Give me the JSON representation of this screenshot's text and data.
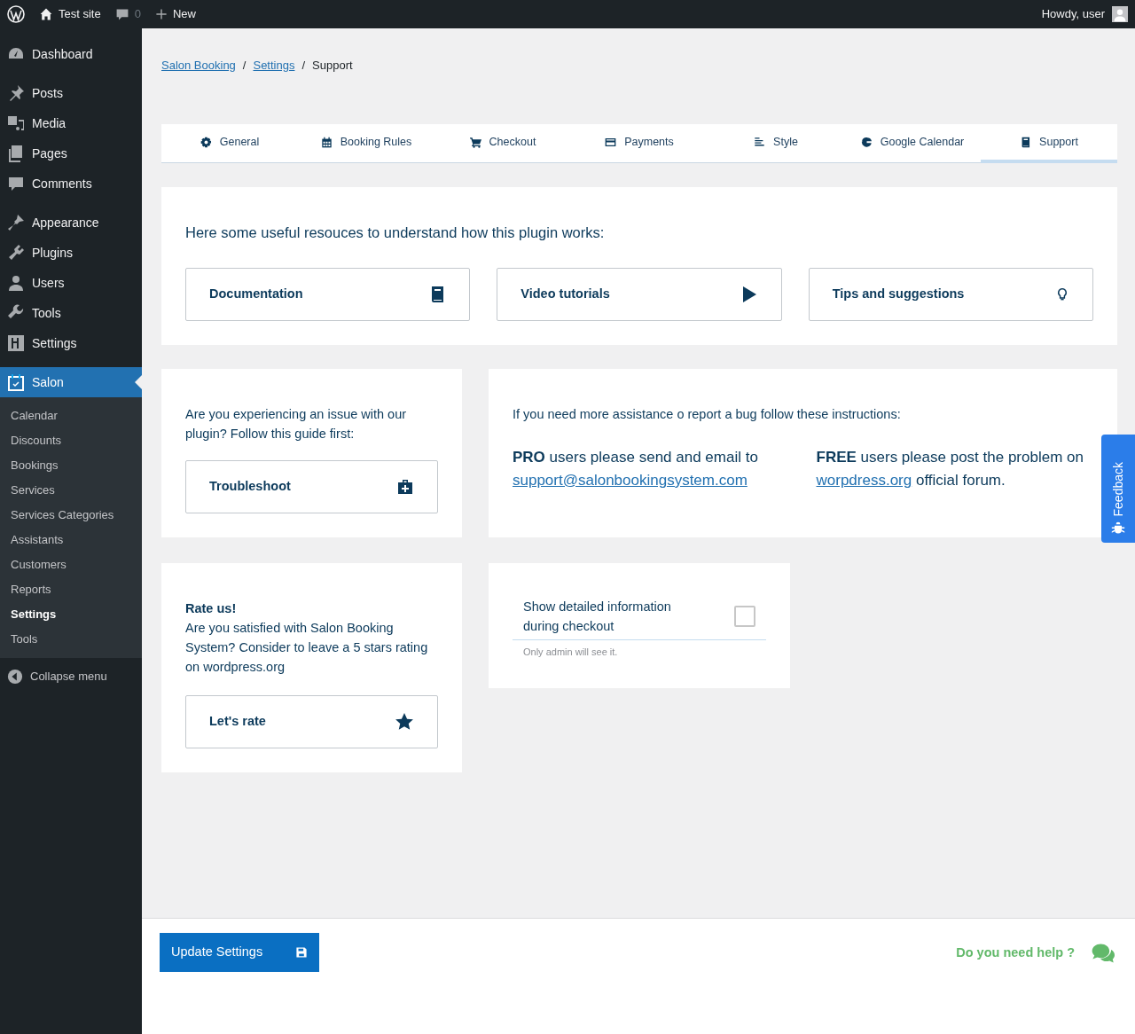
{
  "admin_bar": {
    "site": "Test site",
    "comments": "0",
    "new": "New",
    "greeting": "Howdy, user"
  },
  "sidebar": {
    "groups": [
      [
        {
          "label": "Dashboard",
          "selected": false
        }
      ],
      [
        {
          "label": "Posts",
          "selected": false
        },
        {
          "label": "Media",
          "selected": false
        },
        {
          "label": "Pages",
          "selected": false
        },
        {
          "label": "Comments",
          "selected": false
        }
      ],
      [
        {
          "label": "Appearance",
          "selected": false
        },
        {
          "label": "Plugins",
          "selected": false
        },
        {
          "label": "Users",
          "selected": false
        },
        {
          "label": "Tools",
          "selected": false
        },
        {
          "label": "Settings",
          "selected": false
        }
      ],
      [
        {
          "label": "Salon",
          "selected": true
        }
      ]
    ],
    "submenu": [
      {
        "label": "Calendar",
        "selected": false
      },
      {
        "label": "Discounts",
        "selected": false
      },
      {
        "label": "Bookings",
        "selected": false
      },
      {
        "label": "Services",
        "selected": false
      },
      {
        "label": "Services Categories",
        "selected": false
      },
      {
        "label": "Assistants",
        "selected": false
      },
      {
        "label": "Customers",
        "selected": false
      },
      {
        "label": "Reports",
        "selected": false
      },
      {
        "label": "Settings",
        "selected": true
      },
      {
        "label": "Tools",
        "selected": false
      }
    ],
    "collapse": "Collapse menu"
  },
  "breadcrumb": [
    {
      "label": "Salon Booking",
      "kind": "link"
    },
    {
      "label": "/",
      "kind": "separator"
    },
    {
      "label": "Settings",
      "kind": "link"
    },
    {
      "label": "/",
      "kind": "separator"
    },
    {
      "label": "Support",
      "kind": "current"
    }
  ],
  "tabs": [
    {
      "label": "General",
      "selected": false
    },
    {
      "label": "Booking Rules",
      "selected": false
    },
    {
      "label": "Checkout",
      "selected": false
    },
    {
      "label": "Payments",
      "selected": false
    },
    {
      "label": "Style",
      "selected": false
    },
    {
      "label": "Google Calendar",
      "selected": false
    },
    {
      "label": "Support",
      "selected": true
    }
  ],
  "resources": {
    "title": "Here some useful resouces to understand how this plugin works:",
    "buttons": [
      "Documentation",
      "Video tutorials",
      "Tips and suggestions"
    ]
  },
  "issue": {
    "text": "Are you experiencing an issue with our plugin? Follow this guide first:",
    "button": "Troubleshoot"
  },
  "assistance": {
    "intro": "If you need more assistance o report a bug follow these instructions:",
    "pro": {
      "text": "**PRO** users please send and email to",
      "link": "support@salonbookingsystem.com"
    },
    "free": {
      "text": "**FREE** users please post the problem on",
      "link": "worpdress.org",
      "after": "official forum."
    }
  },
  "rate": {
    "title": "Rate us!",
    "text": "Are you satisfied with Salon Booking System? Consider to leave a 5 stars rating on wordpress.org",
    "button": "Let's rate"
  },
  "option": {
    "label": "Show detailed information during checkout",
    "checked": false,
    "hint": "Only admin will see it."
  },
  "footer": {
    "button": "Update Settings",
    "help": "Do you need help ?"
  },
  "feedback": "Feedback"
}
